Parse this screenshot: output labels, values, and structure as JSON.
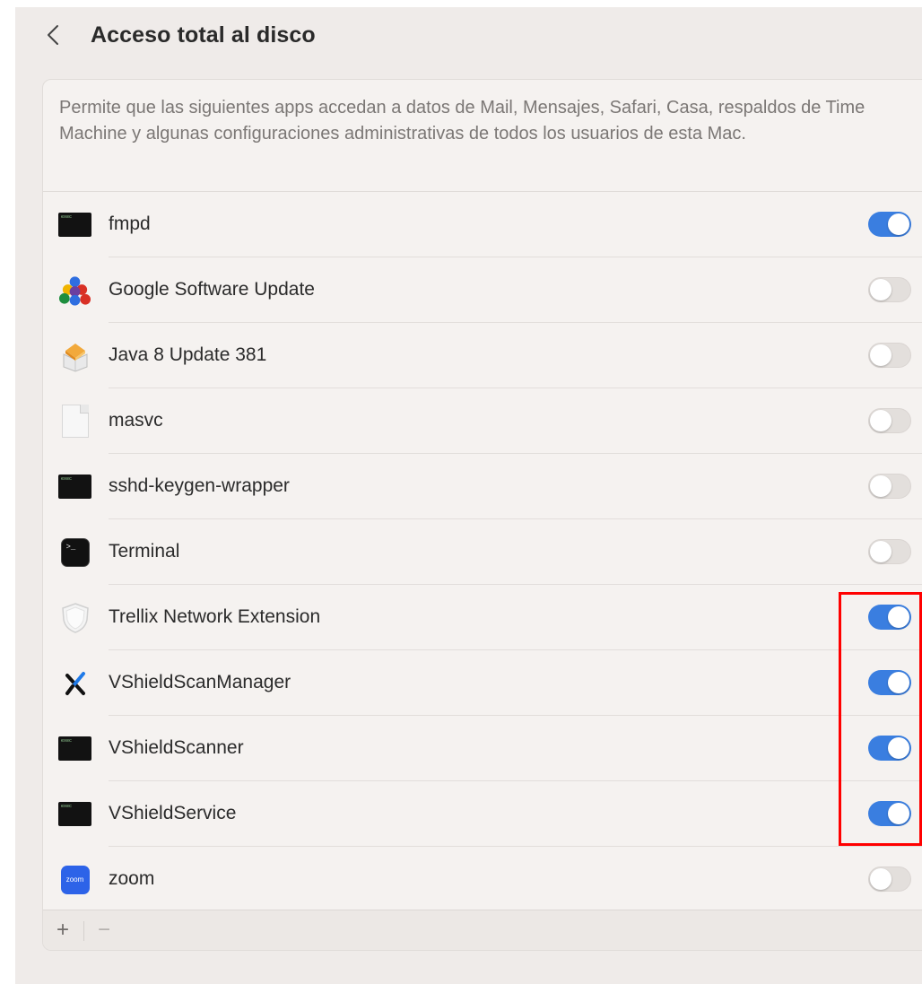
{
  "header": {
    "title": "Acceso total al disco"
  },
  "description": "Permite que las siguientes apps accedan a datos de Mail, Mensajes, Safari, Casa, respaldos de Time Machine y algunas configuraciones administrativas de todos los usuarios de esta Mac.",
  "apps": [
    {
      "name": "fmpd",
      "icon": "exec-icon",
      "enabled": true
    },
    {
      "name": "Google Software Update",
      "icon": "google-software-update-icon",
      "enabled": false
    },
    {
      "name": "Java 8 Update 381",
      "icon": "java-installer-icon",
      "enabled": false
    },
    {
      "name": "masvc",
      "icon": "blank-document-icon",
      "enabled": false
    },
    {
      "name": "sshd-keygen-wrapper",
      "icon": "exec-icon",
      "enabled": false
    },
    {
      "name": "Terminal",
      "icon": "terminal-icon",
      "enabled": false
    },
    {
      "name": "Trellix Network Extension",
      "icon": "shield-icon",
      "enabled": true
    },
    {
      "name": "VShieldScanManager",
      "icon": "trellix-x-icon",
      "enabled": true
    },
    {
      "name": "VShieldScanner",
      "icon": "exec-icon",
      "enabled": true
    },
    {
      "name": "VShieldService",
      "icon": "exec-icon",
      "enabled": true
    },
    {
      "name": "zoom",
      "icon": "zoom-icon",
      "enabled": false
    }
  ],
  "footer": {
    "add_label": "+",
    "remove_label": "−"
  },
  "colors": {
    "toggle_on": "#3a7ee0",
    "toggle_off": "#e3dfdc",
    "highlight": "#ff0000"
  }
}
